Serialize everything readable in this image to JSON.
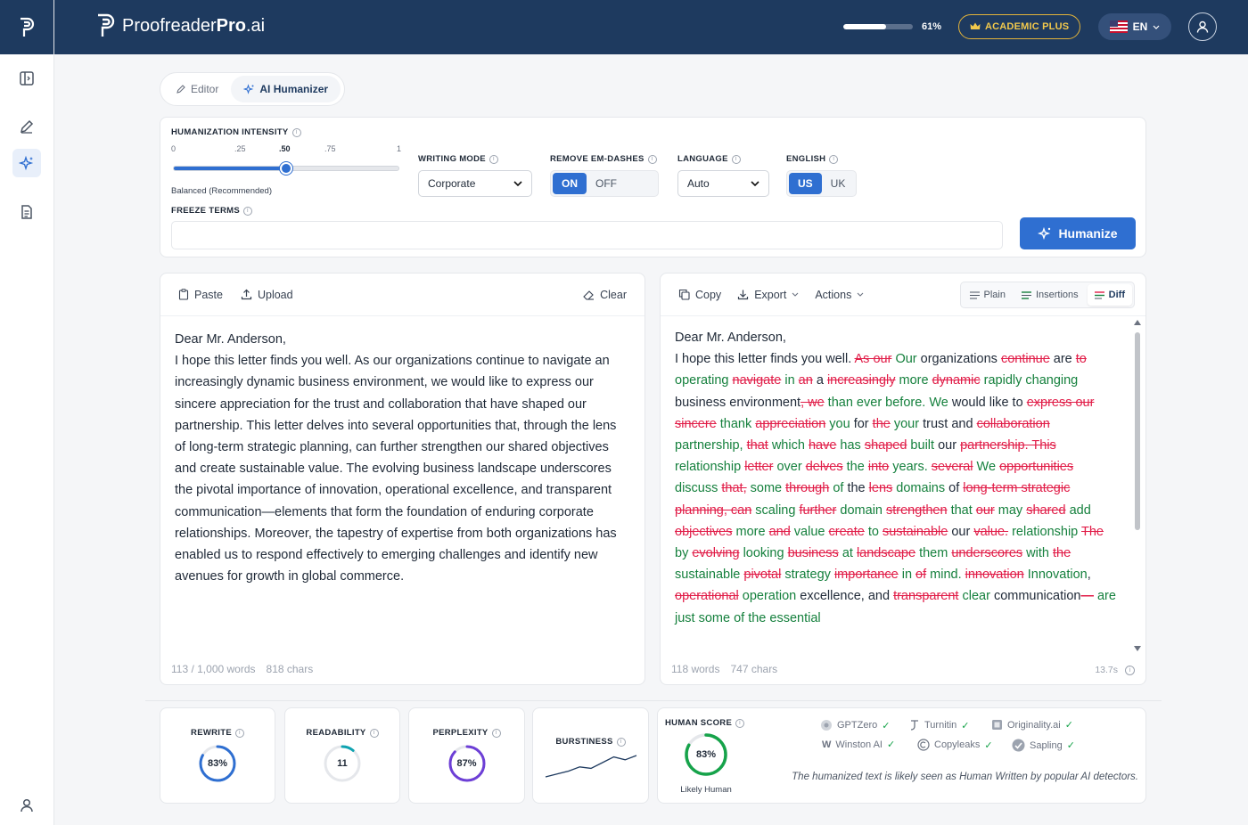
{
  "app": {
    "brand_prefix": "Proofreader",
    "brand_bold": "Pro",
    "brand_suffix": ".ai",
    "usage_percent": 61,
    "usage_label": "61%",
    "plan_badge": "ACADEMIC PLUS",
    "language_code": "EN"
  },
  "tabs": [
    {
      "label": "Editor",
      "active": false
    },
    {
      "label": "AI Humanizer",
      "active": true
    }
  ],
  "settings": {
    "intensity_label": "HUMANIZATION INTENSITY",
    "ticks": [
      "0",
      ".25",
      ".50",
      ".75",
      "1"
    ],
    "intensity_value": 0.5,
    "intensity_caption": "Balanced (Recommended)",
    "writing_mode_label": "WRITING MODE",
    "writing_mode_value": "Corporate",
    "em_dash_label": "REMOVE EM-DASHES",
    "em_dash_on": "ON",
    "em_dash_off": "OFF",
    "language_label": "LANGUAGE",
    "language_value": "Auto",
    "english_label": "ENGLISH",
    "english_us": "US",
    "english_uk": "UK",
    "freeze_label": "FREEZE TERMS",
    "freeze_value": "",
    "humanize_button": "Humanize"
  },
  "input_panel": {
    "paste": "Paste",
    "upload": "Upload",
    "clear": "Clear",
    "salutation": "Dear Mr. Anderson,",
    "body": "I hope this letter finds you well. As our organizations continue to navigate an increasingly dynamic business environment, we would like to express our sincere appreciation for the trust and collaboration that have shaped our partnership. This letter delves into several opportunities that, through the lens of long-term strategic planning, can further strengthen our shared objectives and create sustainable value. The evolving business landscape underscores the pivotal importance of innovation, operational excellence, and transparent communication—elements that form the foundation of enduring corporate relationships. Moreover, the tapestry of expertise from both organizations has enabled us to respond effectively to emerging challenges and identify new avenues for growth in global commerce.",
    "word_count": "113 / 1,000 words",
    "char_count": "818 chars"
  },
  "output_panel": {
    "copy": "Copy",
    "export": "Export",
    "actions": "Actions",
    "views": [
      "Plain",
      "Insertions",
      "Diff"
    ],
    "active_view": "Diff",
    "word_count": "118 words",
    "char_count": "747 chars",
    "time": "13.7s",
    "segments": [
      {
        "t": "n",
        "s": "Dear Mr. Anderson,"
      },
      {
        "t": "br"
      },
      {
        "t": "n",
        "s": " I hope this letter finds you well. "
      },
      {
        "t": "d",
        "s": "As our"
      },
      {
        "t": "i",
        "s": " Our"
      },
      {
        "t": "n",
        "s": " organizations "
      },
      {
        "t": "d",
        "s": "continue"
      },
      {
        "t": "n",
        "s": " are "
      },
      {
        "t": "d",
        "s": "to"
      },
      {
        "t": "i",
        "s": " operating "
      },
      {
        "t": "d",
        "s": "navigate"
      },
      {
        "t": "i",
        "s": " in "
      },
      {
        "t": "d",
        "s": "an"
      },
      {
        "t": "n",
        "s": " a "
      },
      {
        "t": "d",
        "s": "increasingly"
      },
      {
        "t": "i",
        "s": " more "
      },
      {
        "t": "d",
        "s": "dynamic"
      },
      {
        "t": "i",
        "s": " rapidly changing"
      },
      {
        "t": "n",
        "s": " business environment"
      },
      {
        "t": "d",
        "s": ", we"
      },
      {
        "t": "i",
        "s": " than ever before. We "
      },
      {
        "t": "n",
        "s": " would like to "
      },
      {
        "t": "d",
        "s": "express our sincere"
      },
      {
        "t": "i",
        "s": " thank "
      },
      {
        "t": "d",
        "s": "appreciation"
      },
      {
        "t": "i",
        "s": " you "
      },
      {
        "t": "n",
        "s": "for "
      },
      {
        "t": "d",
        "s": "the"
      },
      {
        "t": "i",
        "s": " your "
      },
      {
        "t": "n",
        "s": " trust and "
      },
      {
        "t": "d",
        "s": "collaboration"
      },
      {
        "t": "i",
        "s": " partnership, "
      },
      {
        "t": "d",
        "s": "that"
      },
      {
        "t": "i",
        "s": " which "
      },
      {
        "t": "d",
        "s": "have"
      },
      {
        "t": "i",
        "s": " has "
      },
      {
        "t": "d",
        "s": "shaped"
      },
      {
        "t": "i",
        "s": " built "
      },
      {
        "t": "n",
        "s": " our "
      },
      {
        "t": "d",
        "s": "partnership. This"
      },
      {
        "t": "i",
        "s": " relationship "
      },
      {
        "t": "d",
        "s": "letter"
      },
      {
        "t": "i",
        "s": " over "
      },
      {
        "t": "d",
        "s": "delves"
      },
      {
        "t": "i",
        "s": " the "
      },
      {
        "t": "d",
        "s": "into"
      },
      {
        "t": "i",
        "s": " years. "
      },
      {
        "t": "d",
        "s": "several"
      },
      {
        "t": "i",
        "s": " We "
      },
      {
        "t": "d",
        "s": "opportunities"
      },
      {
        "t": "i",
        "s": " discuss "
      },
      {
        "t": "d",
        "s": "that,"
      },
      {
        "t": "i",
        "s": " some "
      },
      {
        "t": "d",
        "s": "through"
      },
      {
        "t": "i",
        "s": " of "
      },
      {
        "t": "n",
        "s": " the "
      },
      {
        "t": "d",
        "s": "lens"
      },
      {
        "t": "i",
        "s": " domains "
      },
      {
        "t": "n",
        "s": " of "
      },
      {
        "t": "d",
        "s": "long-term strategic planning, can"
      },
      {
        "t": "i",
        "s": " scaling "
      },
      {
        "t": "d",
        "s": "further"
      },
      {
        "t": "i",
        "s": " domain "
      },
      {
        "t": "d",
        "s": "strengthen"
      },
      {
        "t": "i",
        "s": " that "
      },
      {
        "t": "d",
        "s": "our"
      },
      {
        "t": "i",
        "s": " may "
      },
      {
        "t": "d",
        "s": "shared"
      },
      {
        "t": "i",
        "s": " add "
      },
      {
        "t": "d",
        "s": "objectives"
      },
      {
        "t": "i",
        "s": " more "
      },
      {
        "t": "d",
        "s": "and"
      },
      {
        "t": "i",
        "s": " value "
      },
      {
        "t": "d",
        "s": "create"
      },
      {
        "t": "i",
        "s": " to "
      },
      {
        "t": "d",
        "s": "sustainable"
      },
      {
        "t": "n",
        "s": " our "
      },
      {
        "t": "d",
        "s": "value."
      },
      {
        "t": "i",
        "s": " relationship "
      },
      {
        "t": "d",
        "s": "The"
      },
      {
        "t": "i",
        "s": " by "
      },
      {
        "t": "d",
        "s": "evolving"
      },
      {
        "t": "i",
        "s": " looking "
      },
      {
        "t": "d",
        "s": "business"
      },
      {
        "t": "i",
        "s": " at "
      },
      {
        "t": "d",
        "s": "landscape"
      },
      {
        "t": "i",
        "s": " them "
      },
      {
        "t": "d",
        "s": "underscores"
      },
      {
        "t": "i",
        "s": " with "
      },
      {
        "t": "d",
        "s": "the"
      },
      {
        "t": "i",
        "s": " sustainable "
      },
      {
        "t": "d",
        "s": "pivotal"
      },
      {
        "t": "i",
        "s": " strategy "
      },
      {
        "t": "d",
        "s": "importance"
      },
      {
        "t": "i",
        "s": " in "
      },
      {
        "t": "d",
        "s": "of"
      },
      {
        "t": "i",
        "s": " mind. "
      },
      {
        "t": "d",
        "s": "innovation"
      },
      {
        "t": "i",
        "s": " Innovation"
      },
      {
        "t": "n",
        "s": ", "
      },
      {
        "t": "d",
        "s": "operational"
      },
      {
        "t": "i",
        "s": " operation"
      },
      {
        "t": "n",
        "s": " excellence, and "
      },
      {
        "t": "d",
        "s": "transparent"
      },
      {
        "t": "i",
        "s": " clear "
      },
      {
        "t": "n",
        "s": " communication"
      },
      {
        "t": "d",
        "s": "—"
      },
      {
        "t": "i",
        "s": " are just some of the essential"
      }
    ]
  },
  "metrics": [
    {
      "label": "REWRITE",
      "value": 83,
      "display": "83%",
      "color": "#2f6fd1"
    },
    {
      "label": "READABILITY",
      "value": 11,
      "display": "11",
      "color": "#0fa3b1"
    },
    {
      "label": "PERPLEXITY",
      "value": 87,
      "display": "87%",
      "color": "#6d3fd6"
    }
  ],
  "burstiness": {
    "label": "BURSTINESS",
    "points": [
      3,
      5,
      7,
      10,
      9,
      13,
      17,
      15,
      18
    ]
  },
  "human_score": {
    "label": "HUMAN SCORE",
    "value": 83,
    "display": "83%",
    "caption": "Likely Human",
    "color": "#16a34a",
    "detectors": [
      "GPTZero",
      "Turnitin",
      "Originality.ai",
      "Winston AI",
      "Copyleaks",
      "Sapling"
    ],
    "note": "The humanized text is likely seen as Human Written by popular AI detectors."
  }
}
